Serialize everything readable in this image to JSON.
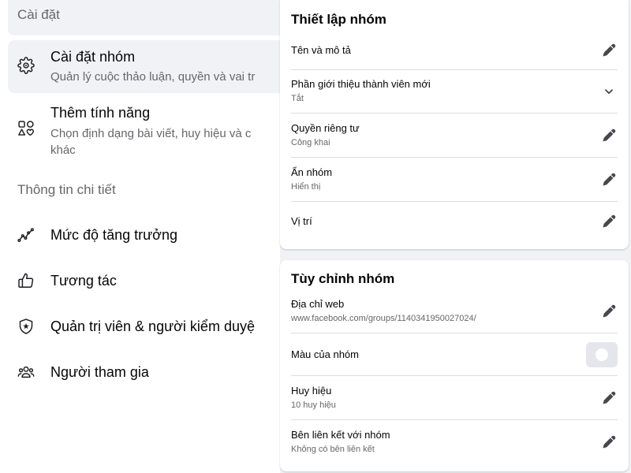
{
  "sidebar": {
    "header": "Cài đặt",
    "settings_items": [
      {
        "label": "Cài đặt nhóm",
        "description": [
          "Quản lý cuộc thảo luận, quyền và vai tr"
        ],
        "icon": "gear-icon",
        "selected": true
      },
      {
        "label": "Thêm tính năng",
        "description": [
          "Chọn định dạng bài viết, huy hiệu và c",
          "khác"
        ],
        "icon": "shapes-icon",
        "selected": false
      }
    ],
    "insights_header": "Thông tin chi tiết",
    "insights_items": [
      {
        "label": "Mức độ tăng trưởng",
        "icon": "growth-chart-icon"
      },
      {
        "label": "Tương tác",
        "icon": "thumbs-up-icon"
      },
      {
        "label": "Quản trị viên & người kiểm duyệ",
        "icon": "admin-shield-icon"
      },
      {
        "label": "Người tham gia",
        "icon": "members-icon"
      }
    ]
  },
  "group_setup": {
    "title": "Thiết lập nhóm",
    "rows": [
      {
        "label": "Tên và mô tả",
        "action_icon": "pencil-icon"
      },
      {
        "label": "Phần giới thiệu thành viên mới",
        "value": "Tắt",
        "action_icon": "chevron-down-icon"
      },
      {
        "label": "Quyền riêng tư",
        "value": "Công khai",
        "action_icon": "pencil-icon"
      },
      {
        "label": "Ẩn nhóm",
        "value": "Hiển thị",
        "action_icon": "pencil-icon"
      },
      {
        "label": "Vị trí",
        "action_icon": "pencil-icon"
      }
    ]
  },
  "group_customize": {
    "title": "Tùy chỉnh nhóm",
    "rows": [
      {
        "label": "Địa chỉ web",
        "value": "www.facebook.com/groups/1140341950027024/",
        "action_icon": "pencil-icon"
      },
      {
        "label": "Màu của nhóm",
        "action_icon": "color-swatch"
      },
      {
        "label": "Huy hiệu",
        "value": "10 huy hiệu",
        "action_icon": "pencil-icon"
      },
      {
        "label": "Bên liên kết với nhóm",
        "value": "Không có bên liên kết",
        "action_icon": "pencil-icon"
      }
    ]
  },
  "colors": {
    "page_bg": "#f0f2f5",
    "panel_bg": "#ffffff",
    "card_bg": "#ffffff",
    "text_primary": "#050505",
    "text_secondary": "#65676b",
    "divider": "#dadde1",
    "selected_bg": "#f0f2f5",
    "icon": "#1c1e21",
    "action_icon": "#45484c",
    "swatch_bg": "#e4e6eb",
    "swatch_dot": "#ffffff"
  }
}
